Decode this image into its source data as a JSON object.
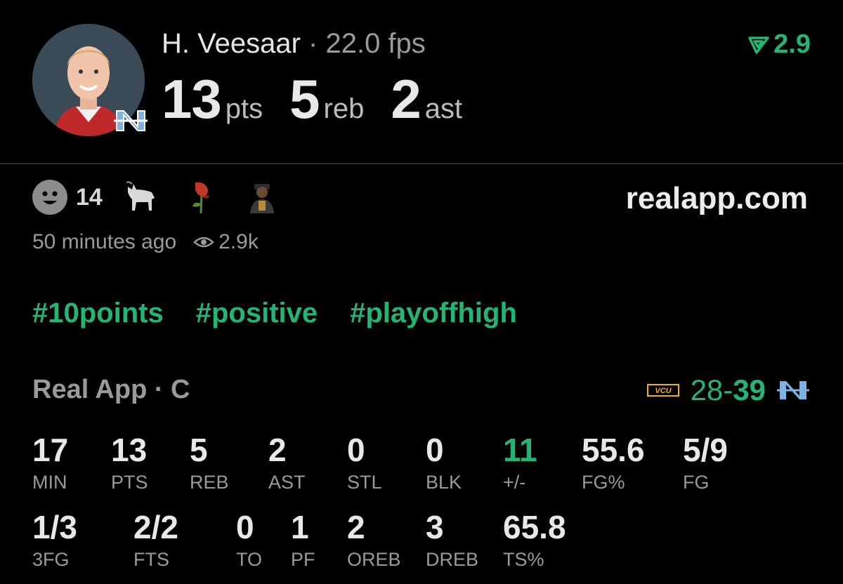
{
  "player": {
    "name": "H. Veesaar",
    "separator": "·",
    "fps": "22.0 fps",
    "pts_value": "13",
    "pts_unit": "pts",
    "reb_value": "5",
    "reb_unit": "reb",
    "ast_value": "2",
    "ast_unit": "ast",
    "avatar_icon": "player-avatar",
    "team_icon": "unc-logo"
  },
  "rating": {
    "icon": "real-rating-icon",
    "value": "2.9"
  },
  "reactions": {
    "smiley_count": "14",
    "emojis": [
      "goat-emoji",
      "wilted-rose-emoji",
      "person-emoji"
    ]
  },
  "site": "realapp.com",
  "meta": {
    "time": "50 minutes ago",
    "views": "2.9k"
  },
  "tags": [
    "#10points",
    "#positive",
    "#playoffhigh"
  ],
  "game": {
    "league": "Real App · C",
    "away_team": "VCU",
    "score_away": "28",
    "score_dash": "-",
    "score_home": "39",
    "home_team": "UNC"
  },
  "stats_row1": [
    {
      "value": "17",
      "label": "MIN"
    },
    {
      "value": "13",
      "label": "PTS"
    },
    {
      "value": "5",
      "label": "REB"
    },
    {
      "value": "2",
      "label": "AST"
    },
    {
      "value": "0",
      "label": "STL"
    },
    {
      "value": "0",
      "label": "BLK"
    },
    {
      "value": "11",
      "label": "+/-"
    },
    {
      "value": "55.6",
      "label": "FG%"
    },
    {
      "value": "5/9",
      "label": "FG"
    }
  ],
  "stats_row2": [
    {
      "value": "1/3",
      "label": "3FG"
    },
    {
      "value": "2/2",
      "label": "FTS"
    },
    {
      "value": "0",
      "label": "TO"
    },
    {
      "value": "1",
      "label": "PF"
    },
    {
      "value": "2",
      "label": "OREB"
    },
    {
      "value": "3",
      "label": "DREB"
    },
    {
      "value": "65.8",
      "label": "TS%"
    }
  ],
  "colors": {
    "accent": "#22b573",
    "background": "#000000",
    "muted": "#9a9a9a"
  }
}
